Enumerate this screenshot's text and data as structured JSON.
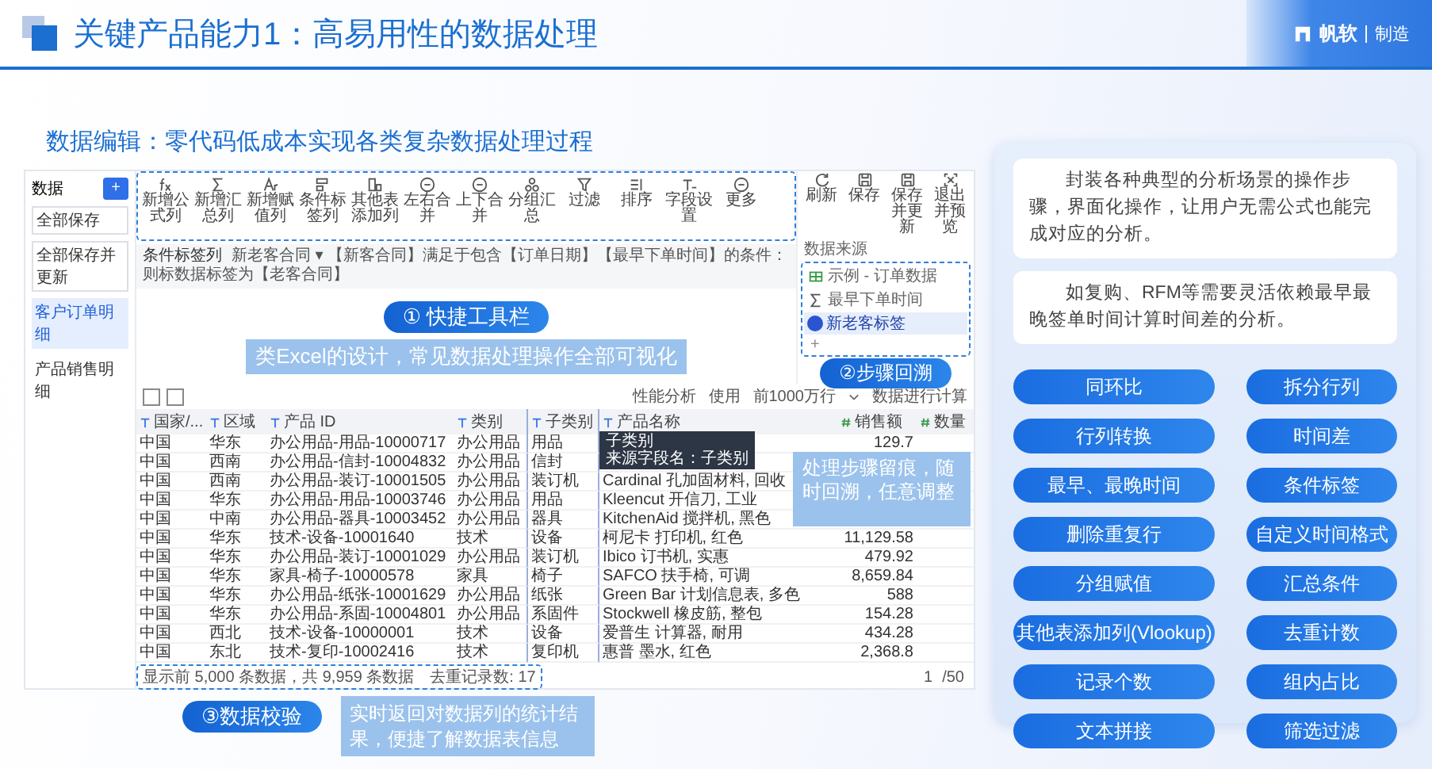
{
  "header": {
    "title": "关键产品能力1：高易用性的数据处理",
    "brand": "帆软",
    "division": "制造"
  },
  "subtitle": "数据编辑：零代码低成本实现各类复杂数据处理过程",
  "app": {
    "sidebar": {
      "title": "数据",
      "add": "+",
      "buttons": [
        "全部保存",
        "全部保存并更新"
      ],
      "items": [
        {
          "label": "客户订单明细",
          "selected": true
        },
        {
          "label": "产品销售明细",
          "selected": false
        }
      ]
    },
    "toolbar": [
      {
        "label": "新增公式列",
        "kind": "formula"
      },
      {
        "label": "新增汇总列",
        "kind": "sum"
      },
      {
        "label": "新增赋值列",
        "kind": "text"
      },
      {
        "label": "条件标签列",
        "kind": "tag"
      },
      {
        "label": "其他表添加列",
        "kind": "table"
      },
      {
        "label": "左右合并",
        "kind": "merge"
      },
      {
        "label": "上下合并",
        "kind": "merge"
      },
      {
        "label": "分组汇总",
        "kind": "group"
      },
      {
        "label": "过滤",
        "kind": "filter"
      },
      {
        "label": "排序",
        "kind": "sort"
      },
      {
        "label": "字段设置",
        "kind": "field"
      },
      {
        "label": "更多",
        "kind": "more"
      }
    ],
    "actions": [
      {
        "label": "刷新",
        "kind": "refresh"
      },
      {
        "label": "保存",
        "kind": "save"
      },
      {
        "label": "保存并更新",
        "kind": "save"
      },
      {
        "label": "退出并预览",
        "kind": "exit"
      }
    ],
    "condition": {
      "label": "条件标签列",
      "text": "新老客合同 ▾ 【新客合同】满足于包含【订单日期】【最早下单时间】的条件：",
      "result": "则标数据标签为【老客合同】"
    },
    "steps": {
      "title": "数据来源",
      "items": [
        {
          "label": "示例 - 订单数据",
          "kind": "source",
          "selected": false
        },
        {
          "label": "最早下单时间",
          "kind": "sum",
          "selected": false
        },
        {
          "label": "新老客标签",
          "kind": "tag",
          "selected": true
        }
      ],
      "add": "+"
    },
    "table_toolbar": {
      "analysis": "性能分析",
      "use": "使用",
      "rows_option": "前1000万行",
      "compute": "数据进行计算"
    },
    "table": {
      "columns": [
        {
          "label": "国家/...",
          "kind": "text",
          "selected": false
        },
        {
          "label": "区域",
          "kind": "text",
          "selected": false
        },
        {
          "label": "产品 ID",
          "kind": "text",
          "selected": false
        },
        {
          "label": "类别",
          "kind": "text",
          "selected": false
        },
        {
          "label": "子类别",
          "kind": "text",
          "selected": true
        },
        {
          "label": "产品名称",
          "kind": "text",
          "selected": false
        },
        {
          "label": "销售额",
          "kind": "number",
          "selected": false
        },
        {
          "label": "数量",
          "kind": "number",
          "selected": false
        }
      ],
      "rows": [
        [
          "中国",
          "华东",
          "办公用品-用品-10000717",
          "办公用品",
          "用品",
          null,
          "129.7"
        ],
        [
          "中国",
          "西南",
          "办公用品-信封-10004832",
          "办公用品",
          "信封",
          null,
          null
        ],
        [
          "中国",
          "西南",
          "办公用品-装订-10001505",
          "办公用品",
          "装订机",
          "Cardinal 孔加固材料, 回收",
          null
        ],
        [
          "中国",
          "华东",
          "办公用品-用品-10003746",
          "办公用品",
          "用品",
          "Kleencut 开信刀, 工业",
          null
        ],
        [
          "中国",
          "中南",
          "办公用品-器具-10003452",
          "办公用品",
          "器具",
          "KitchenAid 搅拌机, 黑色",
          null
        ],
        [
          "中国",
          "华东",
          "技术-设备-10001640",
          "技术",
          "设备",
          "柯尼卡 打印机, 红色",
          "11,129.58"
        ],
        [
          "中国",
          "华东",
          "办公用品-装订-10001029",
          "办公用品",
          "装订机",
          "Ibico 订书机, 实惠",
          "479.92"
        ],
        [
          "中国",
          "华东",
          "家具-椅子-10000578",
          "家具",
          "椅子",
          "SAFCO 扶手椅, 可调",
          "8,659.84"
        ],
        [
          "中国",
          "华东",
          "办公用品-纸张-10001629",
          "办公用品",
          "纸张",
          "Green Bar 计划信息表, 多色",
          "588"
        ],
        [
          "中国",
          "华东",
          "办公用品-系固-10004801",
          "办公用品",
          "系固件",
          "Stockwell 橡皮筋, 整包",
          "154.28"
        ],
        [
          "中国",
          "西北",
          "技术-设备-10000001",
          "技术",
          "设备",
          "爱普生 计算器, 耐用",
          "434.28"
        ],
        [
          "中国",
          "东北",
          "技术-复印-10002416",
          "技术",
          "复印机",
          "惠普 墨水, 红色",
          "2,368.8"
        ]
      ]
    },
    "tooltip": {
      "title": "子类别",
      "text": "来源字段名：子类别"
    },
    "footer": {
      "summary": "显示前 5,000 条数据，共 9,959 条数据",
      "distinct": "去重记录数: 17",
      "page": "1",
      "pages": "/50"
    }
  },
  "callouts": [
    {
      "kind": "badge",
      "text": "① 快捷工具栏"
    },
    {
      "kind": "note",
      "text": "类Excel的设计，常见数据处理操作全部可视化"
    },
    {
      "kind": "badge",
      "text": "②步骤回溯"
    },
    {
      "kind": "note",
      "text": "处理步骤留痕，随时回溯，任意调整"
    },
    {
      "kind": "badge",
      "text": "③数据校验"
    },
    {
      "kind": "note",
      "text": "实时返回对数据列的统计结果，便捷了解数据表信息"
    }
  ],
  "features": {
    "cards": [
      "封装各种典型的分析场景的操作步骤，界面化操作，让用户无需公式也能完成对应的分析。",
      "如复购、RFM等需要灵活依赖最早最晚签单时间计算时间差的分析。"
    ],
    "buttons": [
      "同环比",
      "拆分行列",
      "行列转换",
      "时间差",
      "最早、最晚时间",
      "条件标签",
      "删除重复行",
      "自定义时间格式",
      "分组赋值",
      "汇总条件",
      "其他表添加列(Vlookup)",
      "去重计数",
      "记录个数",
      "组内占比",
      "文本拼接",
      "筛选过滤"
    ]
  }
}
